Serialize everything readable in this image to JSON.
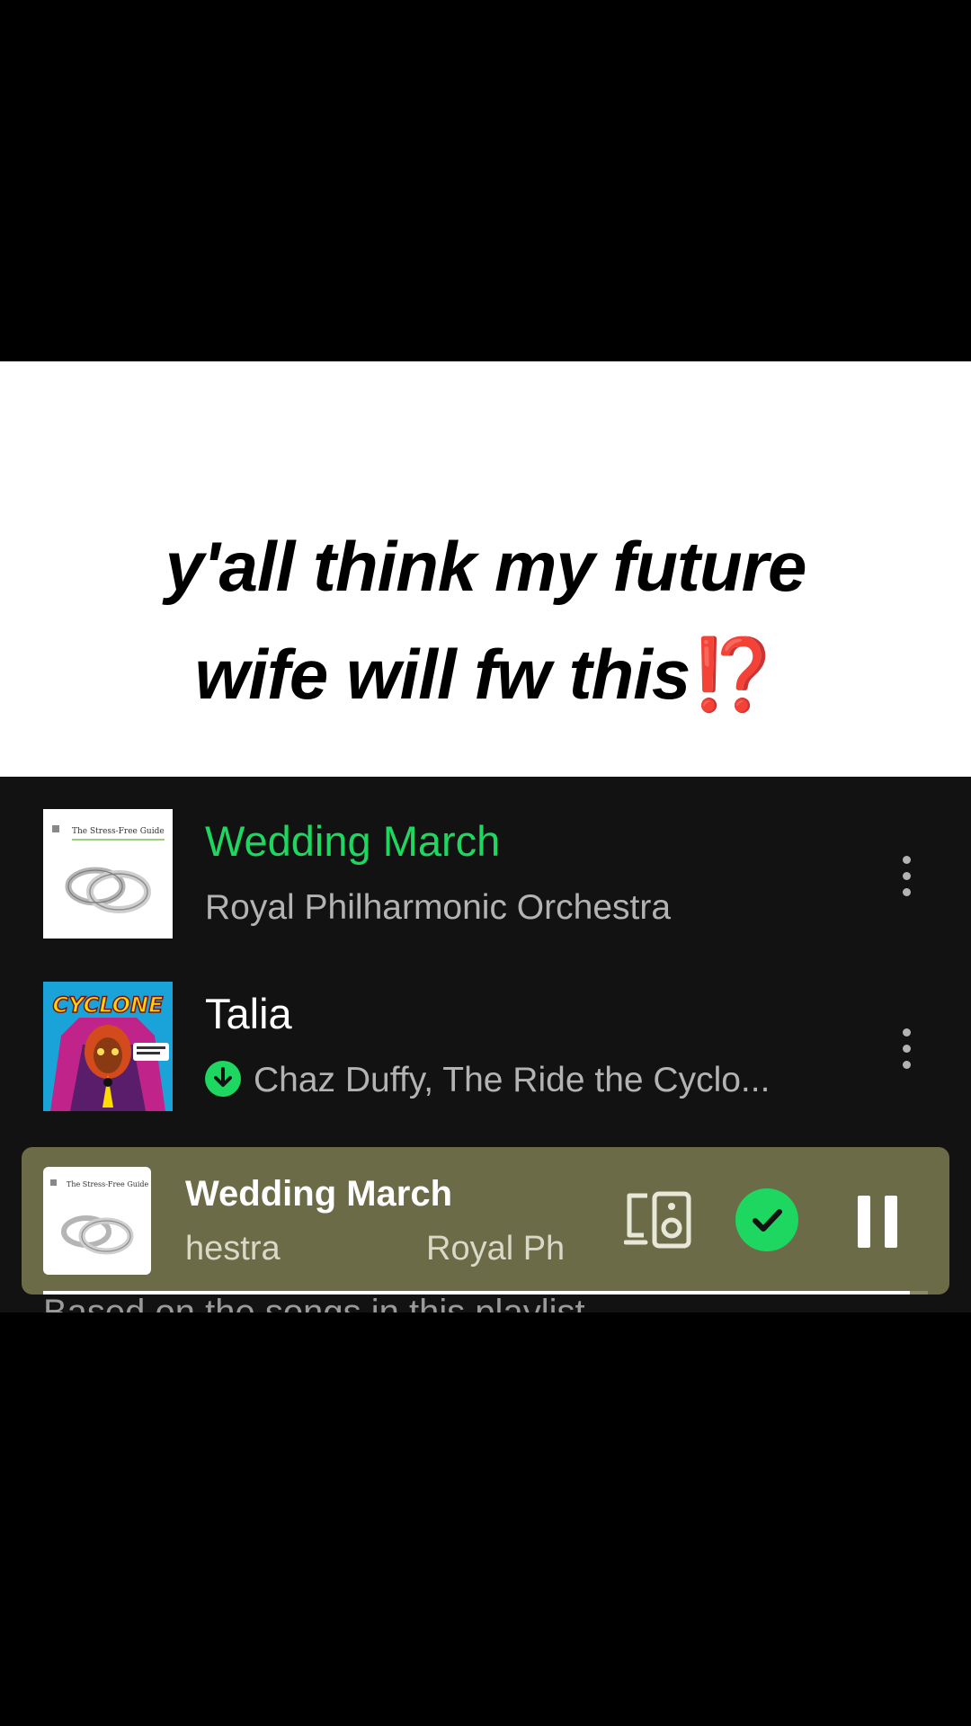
{
  "caption": {
    "line1": "y'all think my future",
    "line2": "wife will fw this",
    "emoji": "⁉️"
  },
  "tracks": [
    {
      "title": "Wedding March",
      "artist": "Royal Philharmonic Orchestra",
      "playing": true,
      "downloaded": false,
      "cover_icon": "wedding-rings-icon",
      "cover_text": "The Stress-Free Guide"
    },
    {
      "title": "Talia",
      "artist": "Chaz Duffy, The Ride the Cyclo...",
      "playing": false,
      "downloaded": true,
      "cover_icon": "cyclone-album-art",
      "cover_text": "CYCLONE"
    }
  ],
  "now_playing": {
    "title": "Wedding March",
    "subtitle_part_a": "hestra",
    "subtitle_part_b": "Royal Ph",
    "cover_text": "The Stress-Free Guide",
    "progress": 0.98,
    "saved": true,
    "state": "playing"
  },
  "below_text": "Based on the songs in this playlist",
  "colors": {
    "accent_green": "#1ed760",
    "app_background": "#121212",
    "player_background": "#6b6b47",
    "caption_emoji": "#e01b1b"
  },
  "icons": {
    "more": "more-options-icon",
    "download": "downloaded-icon",
    "device": "connect-device-icon",
    "saved": "saved-check-icon",
    "pause": "pause-icon"
  }
}
